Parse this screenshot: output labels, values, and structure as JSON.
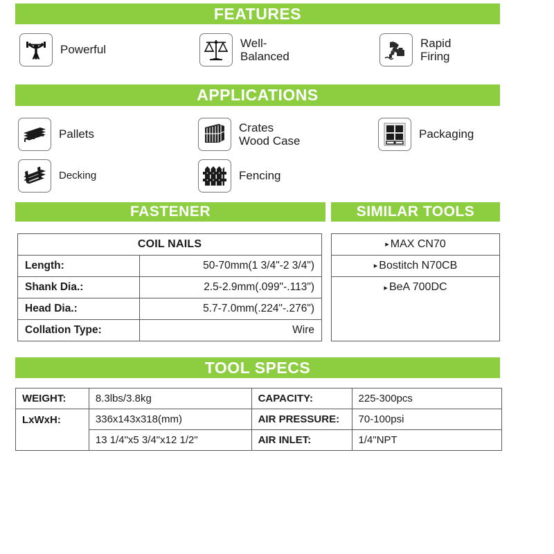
{
  "sections": {
    "features": "FEATURES",
    "applications": "APPLICATIONS",
    "fastener": "FASTENER",
    "similar_tools": "SIMILAR TOOLS",
    "tool_specs": "TOOL SPECS"
  },
  "colors": {
    "bar_green": "#8DCE40",
    "bar_text": "#FFFFFF",
    "table_border": "#5A5A5A",
    "body_text": "#1A1A1A"
  },
  "features": [
    {
      "icon": "weightlifter-icon",
      "label": "Powerful"
    },
    {
      "icon": "balance-scale-icon",
      "label": "Well-\nBalanced"
    },
    {
      "icon": "nail-gun-firing-icon",
      "label": "Rapid\nFiring"
    }
  ],
  "applications": [
    {
      "icon": "pallet-icon",
      "label": "Pallets"
    },
    {
      "icon": "crate-icon",
      "label": "Crates\nWood Case"
    },
    {
      "icon": "packaging-box-icon",
      "label": "Packaging"
    },
    {
      "icon": "decking-boards-icon",
      "label": "Decking"
    },
    {
      "icon": "fence-icon",
      "label": "Fencing"
    }
  ],
  "fastener_table": {
    "header": "COIL NAILS",
    "rows": [
      {
        "key": "Length:",
        "value": "50-70mm(1 3/4\"-2 3/4\")"
      },
      {
        "key": "Shank Dia.:",
        "value": "2.5-2.9mm(.099\"-.113\")"
      },
      {
        "key": "Head Dia.:",
        "value": "5.7-7.0mm(.224\"-.276\")"
      },
      {
        "key": "Collation Type:",
        "value": "Wire"
      }
    ]
  },
  "similar_tools": {
    "bullet": "▸",
    "items": [
      "MAX CN70",
      "Bostitch N70CB",
      "BeA 700DC"
    ]
  },
  "tool_specs": {
    "rows": [
      {
        "label_left": "WEIGHT:",
        "value_left": "8.3lbs/3.8kg",
        "label_right": "CAPACITY:",
        "value_right": "225-300pcs"
      },
      {
        "label_left": "LxWxH:",
        "value_left": "336x143x318(mm)",
        "label_right": "AIR PRESSURE:",
        "value_right": "70-100psi"
      },
      {
        "label_left": "",
        "value_left": "13 1/4\"x5 3/4\"x12 1/2\"",
        "label_right": "AIR INLET:",
        "value_right": "1/4\"NPT"
      }
    ]
  }
}
